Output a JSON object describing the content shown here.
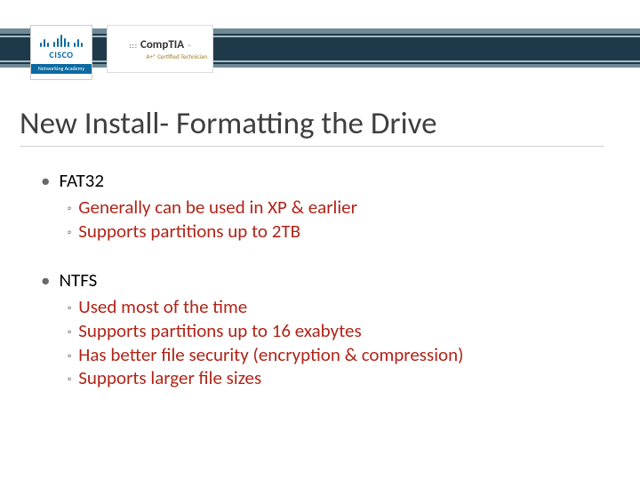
{
  "badges": {
    "cisco": {
      "name": "CISCO",
      "footer": "Networking Academy"
    },
    "comptia": {
      "dots": ":::",
      "name": "CompTIA",
      "tm": "™",
      "sub": "A+® Certified Technician"
    }
  },
  "title": "New Install- Formatting the Drive",
  "sections": [
    {
      "heading": "FAT32",
      "items": [
        "Generally can be used in XP & earlier",
        "Supports partitions up to 2TB"
      ]
    },
    {
      "heading": "NTFS",
      "items": [
        "Used most of the time",
        "Supports partitions up to 16 exabytes",
        "Has better file security (encryption & compression)",
        "Supports larger file sizes"
      ]
    }
  ]
}
